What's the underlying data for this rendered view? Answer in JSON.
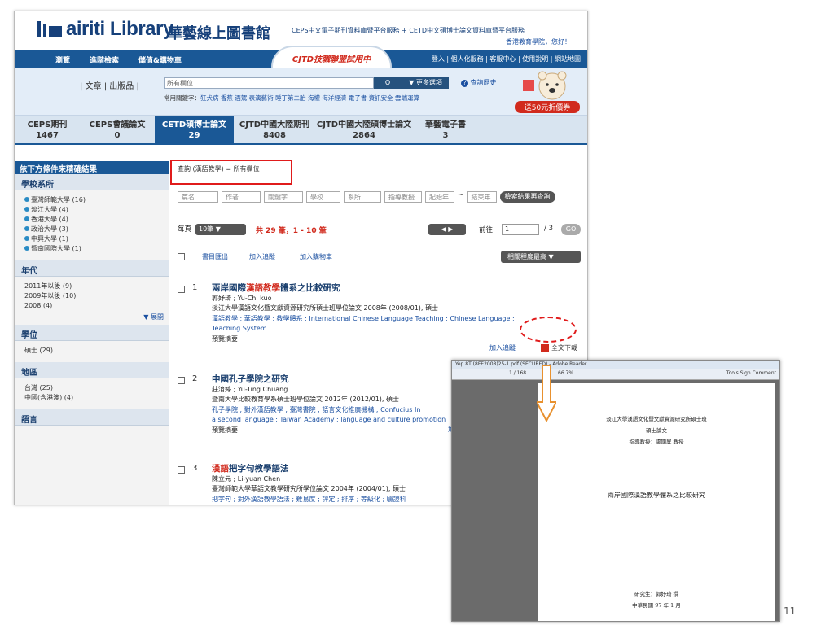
{
  "header": {
    "logo_text": "airiti Library",
    "logo_cn": "華藝線上圖書館",
    "service_info": "CEPS中文電子期刊資料庫暨平台服務 + CETD中文碩博士論文資料庫暨平台服務",
    "greeting": "香港教育學院，您好！"
  },
  "nav": {
    "items": [
      "瀏覽",
      "進階檢索",
      "儲值&購物車"
    ],
    "ribbon": "CJTD技職聯盟試用中",
    "right_links": "登入 | 個人化服務 | 客服中心 | 使用說明 | 網站地圖"
  },
  "search": {
    "categories": "| 文章 | 出版品 |",
    "field": "所有欄位",
    "search_label": "Q",
    "more_label": "▼ 更多選項",
    "history": "查詢歷史",
    "keywords_label": "常用關鍵字：",
    "keywords": [
      "狂犬病",
      "香蕉",
      "酒駕",
      "表演藝術",
      "睡丁第二胎",
      "海權",
      "海洋經濟",
      "電子書",
      "資訊安全",
      "雲端運算"
    ],
    "promo": "送50元折價券"
  },
  "tabs": [
    {
      "name": "CEPS期刊",
      "count": "1467"
    },
    {
      "name": "CEPS會議論文",
      "count": "0"
    },
    {
      "name": "CETD碩博士論文",
      "count": "29"
    },
    {
      "name": "CJTD中國大陸期刊",
      "count": "8408"
    },
    {
      "name": "CJTD中國大陸碩博士論文",
      "count": "2864"
    },
    {
      "name": "華藝電子書",
      "count": "3"
    }
  ],
  "sidebar": {
    "head": "依下方條件來精確結果",
    "sections": [
      {
        "title": "學校系所",
        "items": [
          "臺灣師範大學 (16)",
          "淡江大學 (4)",
          "香港大學 (4)",
          "政治大學 (3)",
          "中興大學 (1)",
          "暨南國際大學 (1)"
        ]
      },
      {
        "title": "年代",
        "items": [
          "2011年以後 (9)",
          "2009年以後 (10)",
          "2008 (4)"
        ],
        "expand": "▼ 展開"
      },
      {
        "title": "學位",
        "items": [
          "碩士 (29)"
        ]
      },
      {
        "title": "地區",
        "items": [
          "台灣 (25)",
          "中國(含港澳) (4)"
        ]
      },
      {
        "title": "語言",
        "items": []
      }
    ]
  },
  "main": {
    "query": "查詢 (漢語教學) = 所有欄位",
    "filters": [
      "篇名",
      "作者",
      "關鍵字",
      "學校",
      "系所",
      "指導教授",
      "起始年",
      "結束年"
    ],
    "year_sep": "~",
    "refine": "檢索結果再查詢",
    "per_page_label": "每頁",
    "per_page": "10筆",
    "total": "共 29 筆，1 - 10 筆",
    "goto_label": "前往",
    "page_input": "1",
    "page_count": "/ 3",
    "go": "GO",
    "tools": [
      "書目匯出",
      "加入追蹤",
      "加入購物車"
    ],
    "sort": "相關程度最高",
    "records": [
      {
        "num": "1",
        "title_pre": "兩岸國際",
        "title_hl": "漢語教學",
        "title_post": "體系之比較研究",
        "author": "郭妤琦 ; Yu-Chi kuo",
        "source": "淡江大學漢語文化暨文獻資源研究所碩士班學位論文 2008年 (2008/01), 碩士",
        "keywords": "漢語教學 ; 華語教學 ; 教學體系 ; International Chinese Language Teaching ; Chinese Language ;",
        "keywords2": "Teaching System",
        "preview": "預覽摘要",
        "track": "加入追蹤",
        "download": "全文下載"
      },
      {
        "num": "2",
        "title_pre": "中國孔子學院之研究",
        "title_hl": "",
        "title_post": "",
        "author": "莊淯婷 ; Yu-Ting Chuang",
        "source": "暨南大學比較教育學系碩士班學位論文 2012年 (2012/01), 碩士",
        "keywords": "孔子學院 ; 對外漢語教學 ; 臺灣書院 ; 語言文化推廣機構 ; Confucius In",
        "keywords2": "a second language ; Taiwan Academy ; language and culture promotion",
        "preview": "預覽摘要",
        "track": "加"
      },
      {
        "num": "3",
        "title_pre": "",
        "title_hl": "漢語",
        "title_post": "把字句教學語法",
        "author": "陳立元 ; Li-yuan Chen",
        "source": "臺灣師範大學華語文教學研究所學位論文 2004年 (2004/01), 碩士",
        "keywords": "把字句 ; 對外漢語教學語法 ; 難易度 ; 評定 ; 排序 ; 等級化 ; 驗證科"
      }
    ]
  },
  "pdf": {
    "title": "Yep 8T (8FE2008)25-1.pdf (SECURED) - Adobe Reader",
    "page_info": "1 / 168",
    "zoom": "66.7%",
    "right": "Tools   Sign   Comment",
    "line1": "淡江大學漢語文化暨文獻資源研究所碩士班",
    "line2": "碩士論文",
    "line3": "指導教授：盧國屏 教授",
    "doc_title": "兩岸國際漢語教學體系之比較研究",
    "student": "研究生：郭妤琦 撰",
    "date": "中華民國 97 年 1 月"
  },
  "slide_page": "11"
}
